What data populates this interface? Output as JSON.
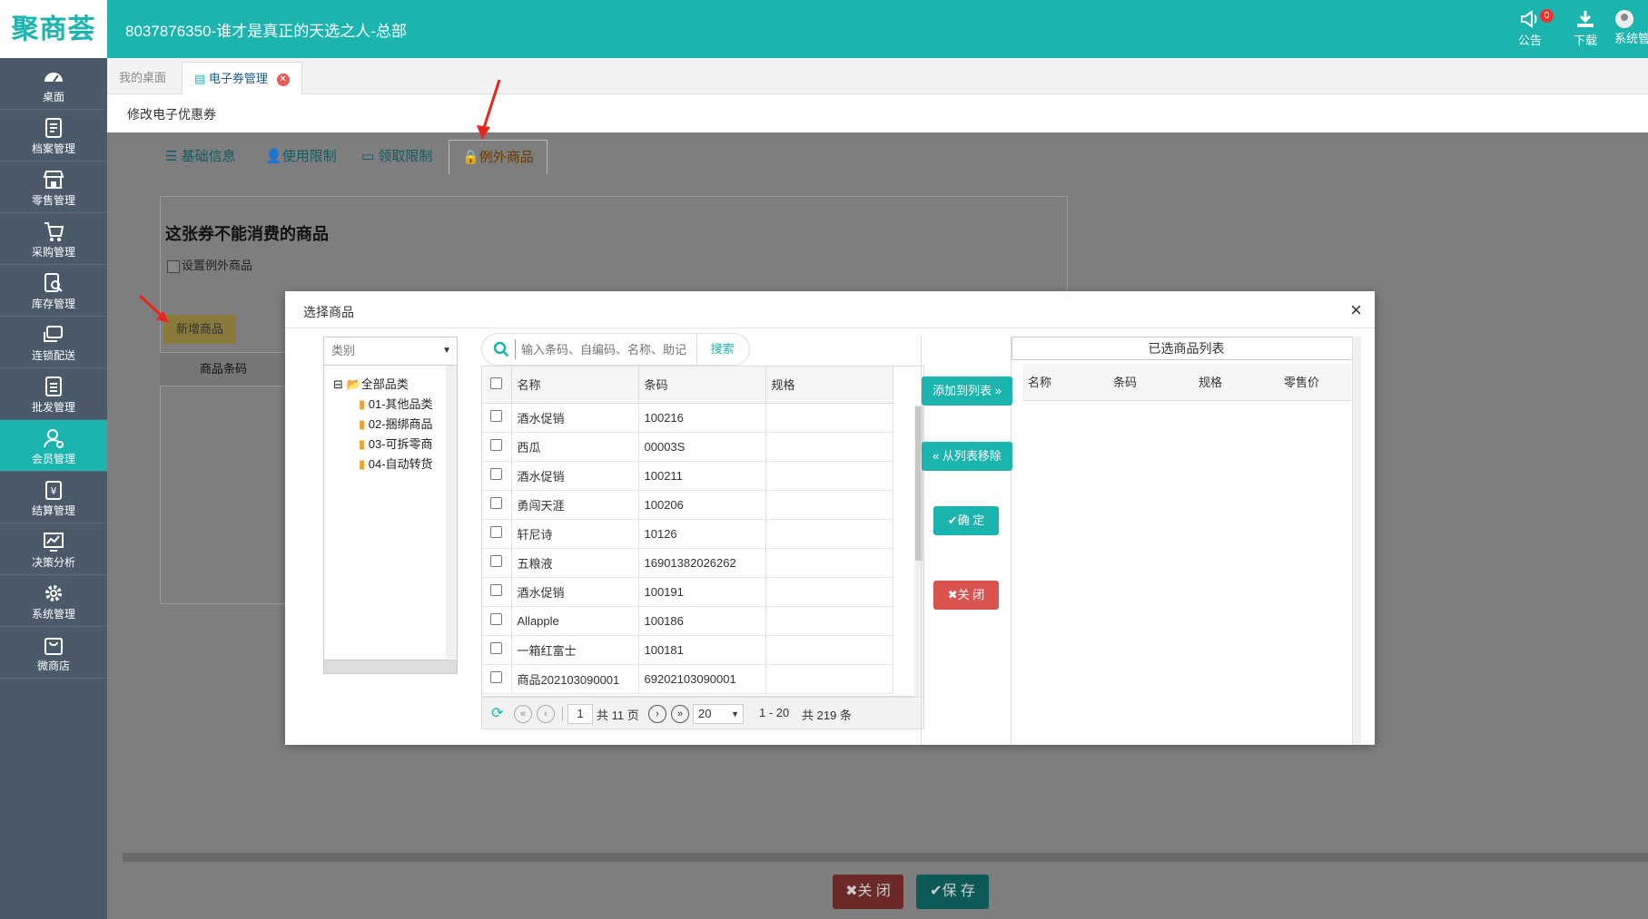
{
  "header": {
    "logo": "聚商荟",
    "tenant": "8037876350-谁才是真正的天选之人-总部",
    "announce_label": "公告",
    "announce_badge": "0",
    "download_label": "下载",
    "system_label": "系统管"
  },
  "sidebar": {
    "items": [
      {
        "label": "桌面",
        "icon": "dashboard-icon"
      },
      {
        "label": "档案管理",
        "icon": "archive-icon"
      },
      {
        "label": "零售管理",
        "icon": "store-icon"
      },
      {
        "label": "采购管理",
        "icon": "purchase-icon"
      },
      {
        "label": "库存管理",
        "icon": "inventory-icon"
      },
      {
        "label": "连锁配送",
        "icon": "delivery-icon"
      },
      {
        "label": "批发管理",
        "icon": "wholesale-icon"
      },
      {
        "label": "会员管理",
        "icon": "member-icon"
      },
      {
        "label": "结算管理",
        "icon": "settlement-icon"
      },
      {
        "label": "决策分析",
        "icon": "analysis-icon"
      },
      {
        "label": "系统管理",
        "icon": "settings-icon"
      },
      {
        "label": "微商店",
        "icon": "shop-bag-icon"
      }
    ],
    "active_index": 7
  },
  "page_tabs": {
    "desktop": "我的桌面",
    "current": "电子券管理"
  },
  "subtitle": "修改电子优惠券",
  "content_tabs": [
    {
      "label": "基础信息"
    },
    {
      "label": "使用限制"
    },
    {
      "label": "领取限制"
    },
    {
      "label": "例外商品"
    }
  ],
  "card": {
    "title": "这张券不能消费的商品",
    "checkbox_label": "设置例外商品",
    "add_button": "新增商品",
    "code_header": "商品条码"
  },
  "footer_buttons": {
    "close": "关 闭",
    "save": "保 存"
  },
  "modal": {
    "title": "选择商品",
    "category_placeholder": "类别",
    "tree": {
      "root": "全部品类",
      "children": [
        "01-其他品类",
        "02-捆绑商品",
        "03-可拆零商",
        "04-自动转货"
      ]
    },
    "search_placeholder": "输入条码、自编码、名称、助记",
    "search_button": "搜索",
    "columns": [
      "名称",
      "条码",
      "规格"
    ],
    "rows": [
      {
        "name": "酒水促销",
        "code": "100216",
        "spec": ""
      },
      {
        "name": "西瓜",
        "code": "00003S",
        "spec": ""
      },
      {
        "name": "酒水促销",
        "code": "100211",
        "spec": ""
      },
      {
        "name": "勇闯天涯",
        "code": "100206",
        "spec": ""
      },
      {
        "name": "轩尼诗",
        "code": "10126",
        "spec": ""
      },
      {
        "name": "五粮液",
        "code": "16901382026262",
        "spec": ""
      },
      {
        "name": "酒水促销",
        "code": "100191",
        "spec": ""
      },
      {
        "name": "Allapple",
        "code": "100186",
        "spec": ""
      },
      {
        "name": "一箱红富士",
        "code": "100181",
        "spec": ""
      },
      {
        "name": "商品202103090001",
        "code": "69202103090001",
        "spec": ""
      }
    ],
    "pager": {
      "page": "1",
      "total_pages": "共 11 页",
      "page_size": "20",
      "range": "1 - 20",
      "total": "共 219 条"
    },
    "buttons": {
      "add": "添加到列表",
      "remove": "从列表移除",
      "confirm": "确 定",
      "close": "关 闭"
    },
    "selected_list": {
      "title": "已选商品列表",
      "columns": [
        "名称",
        "条码",
        "规格",
        "零售价"
      ]
    }
  },
  "colors": {
    "primary": "#1bb4ae",
    "sidebar": "#4a5a6a",
    "danger": "#d9534f",
    "annotation_arrow": "#e8261c"
  }
}
